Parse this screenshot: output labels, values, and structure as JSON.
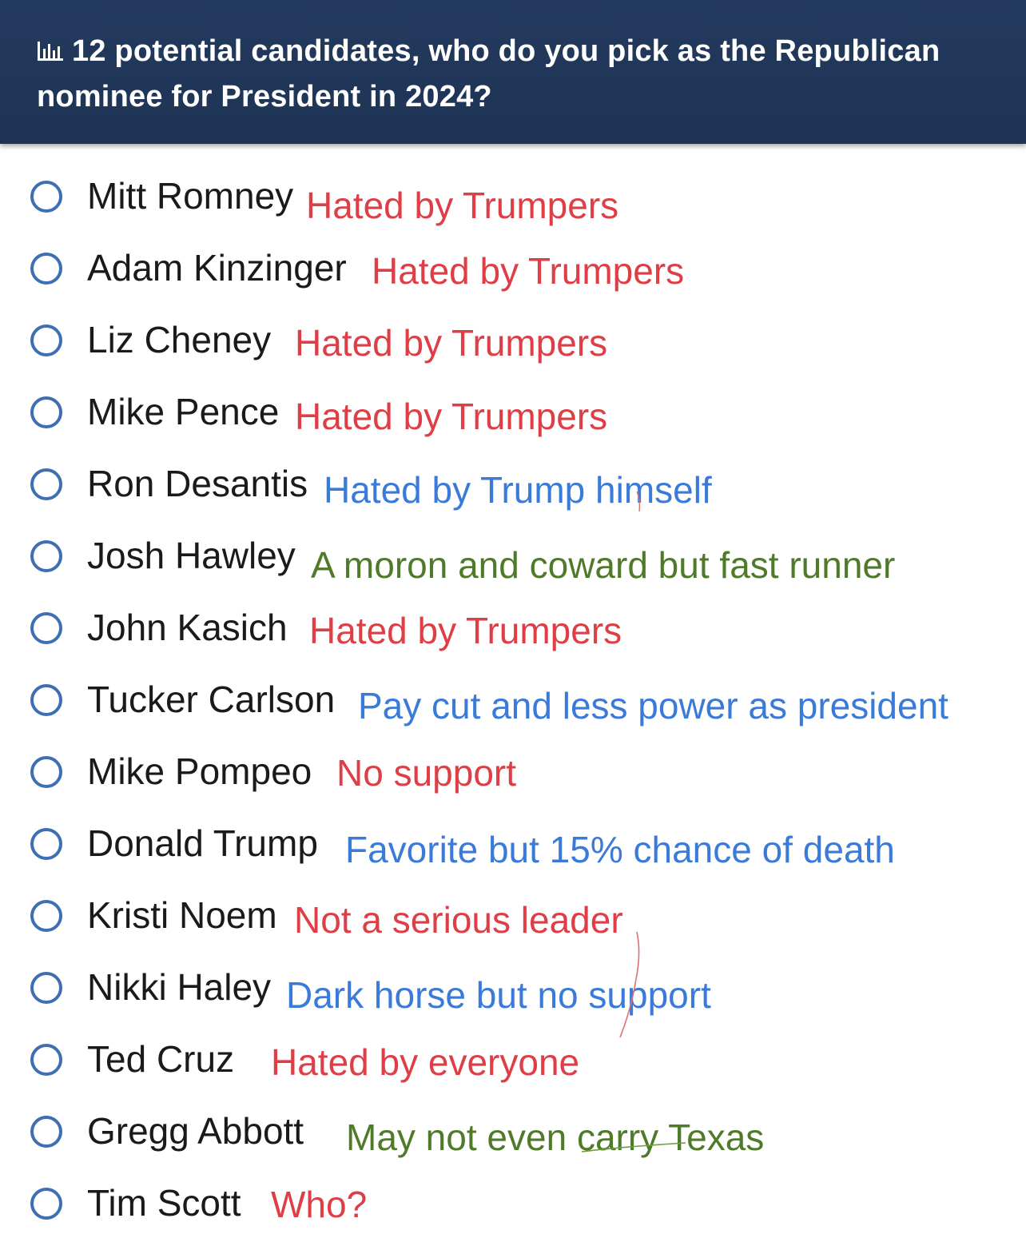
{
  "header": {
    "icon": "poll-chart-icon",
    "title": "12 potential candidates, who do you pick as the Republican nominee for President in 2024?"
  },
  "colors": {
    "header_bg": "#223a5e",
    "radio": "#3f6fb3",
    "red": "#de3e45",
    "blue": "#3a7ad9",
    "green": "#4f7a2a"
  },
  "options": [
    {
      "name": "Mitt Romney",
      "note": "Hated by Trumpers",
      "color": "#de3e45"
    },
    {
      "name": "Adam Kinzinger",
      "note": "Hated by Trumpers",
      "color": "#de3e45"
    },
    {
      "name": "Liz Cheney",
      "note": "Hated by Trumpers",
      "color": "#de3e45"
    },
    {
      "name": "Mike Pence",
      "note": "Hated by Trumpers",
      "color": "#de3e45"
    },
    {
      "name": "Ron Desantis",
      "note": "Hated by Trump himself",
      "color": "#3a7ad9"
    },
    {
      "name": "Josh Hawley",
      "note": "A moron and coward but fast runner",
      "color": "#4f7a2a"
    },
    {
      "name": "John Kasich",
      "note": "Hated by Trumpers",
      "color": "#de3e45"
    },
    {
      "name": "Tucker Carlson",
      "note": "Pay cut and less power as president",
      "color": "#3a7ad9"
    },
    {
      "name": "Mike Pompeo",
      "note": "No support",
      "color": "#de3e45"
    },
    {
      "name": "Donald Trump",
      "note": "Favorite but 15% chance of death",
      "color": "#3a7ad9"
    },
    {
      "name": "Kristi Noem",
      "note": "Not a serious leader",
      "color": "#de3e45"
    },
    {
      "name": "Nikki Haley",
      "note": "Dark horse but no support",
      "color": "#3a7ad9"
    },
    {
      "name": "Ted Cruz",
      "note": "Hated by everyone",
      "color": "#de3e45"
    },
    {
      "name": "Gregg Abbott",
      "note": "May not even carry Texas",
      "color": "#4f7a2a"
    },
    {
      "name": "Tim Scott",
      "note": "Who?",
      "color": "#de3e45"
    }
  ]
}
